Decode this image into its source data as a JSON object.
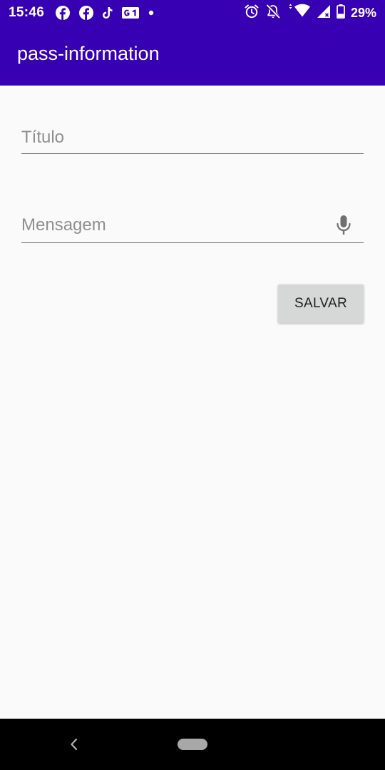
{
  "status_bar": {
    "time": "15:46",
    "notification_icons": [
      "facebook-icon",
      "facebook-icon",
      "tiktok-icon",
      "g1-icon",
      "dot-icon"
    ],
    "system_icons": [
      "alarm-icon",
      "notifications-off-icon",
      "wifi-icon",
      "cell-signal-icon",
      "battery-icon"
    ],
    "battery_percent": "29%"
  },
  "app_bar": {
    "title": "pass-information",
    "color": "#3700b3"
  },
  "form": {
    "title_field": {
      "placeholder": "Título",
      "value": ""
    },
    "message_field": {
      "placeholder": "Mensagem",
      "value": "",
      "trailing_icon": "mic-icon"
    },
    "save_button_label": "SALVAR"
  },
  "navigation_bar": {
    "buttons": [
      "back-icon",
      "home-pill"
    ]
  }
}
